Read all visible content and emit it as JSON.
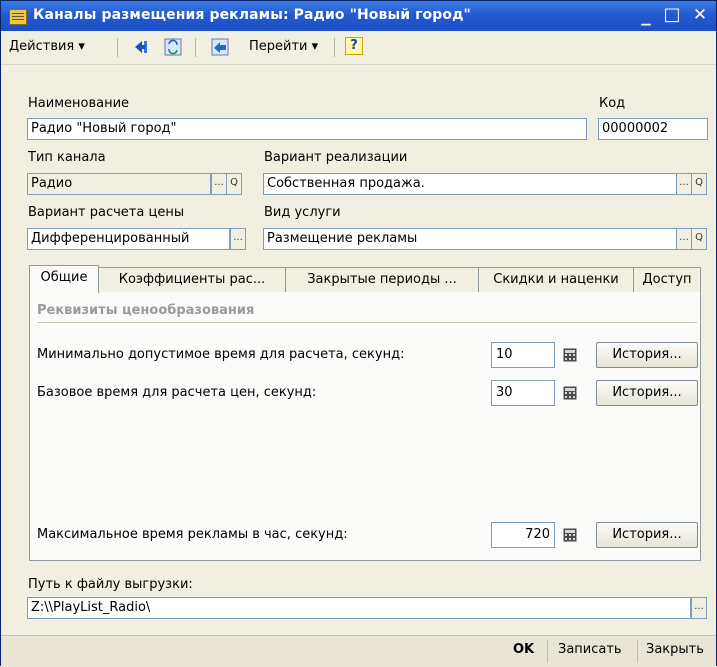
{
  "window": {
    "title": "Каналы размещения рекламы: Радио \"Новый город\"",
    "minimize": "_",
    "maximize": "□",
    "close": "✕"
  },
  "toolbar": {
    "actions_label": "Действия ▾",
    "goto_label": "Перейти ▾",
    "help_label": "?",
    "icons": [
      "arrow-left-icon",
      "refresh-icon",
      "structure-icon",
      "help-icon"
    ]
  },
  "form": {
    "name_label": "Наименование",
    "name_value": "Радио \"Новый город\"",
    "code_label": "Код",
    "code_value": "00000002",
    "channel_type_label": "Тип канала",
    "channel_type_value": "Радио",
    "realization_label": "Вариант реализации",
    "realization_value": "Собственная продажа.",
    "price_calc_label": "Вариант расчета цены",
    "price_calc_value": "Дифференцированный",
    "service_type_label": "Вид услуги",
    "service_type_value": "Размещение рекламы",
    "export_path_label": "Путь к файлу выгрузки:",
    "export_path_value": "Z:\\\\PlayList_Radio\\",
    "select_glyph": "...",
    "search_glyph": "Q"
  },
  "tabs": [
    {
      "label": "Общие"
    },
    {
      "label": "Коэффициенты рас..."
    },
    {
      "label": "Закрытые периоды ..."
    },
    {
      "label": "Скидки и наценки"
    },
    {
      "label": "Доступ"
    }
  ],
  "general": {
    "group_title": "Реквизиты ценообразования",
    "min_time_label": "Минимально допустимое время для расчета, секунд:",
    "min_time_value": "10",
    "base_time_label": "Базовое время для расчета цен, секунд:",
    "base_time_value": "30",
    "max_time_label": "Максимальное время рекламы в час, секунд:",
    "max_time_value": "720",
    "history_label": "История..."
  },
  "footer": {
    "ok_label": "OK",
    "save_label": "Записать",
    "close_label": "Закрыть"
  },
  "colors": {
    "titlebar": "#245edb",
    "window_bg": "#f1efe2",
    "field_border": "#7f9db9"
  }
}
